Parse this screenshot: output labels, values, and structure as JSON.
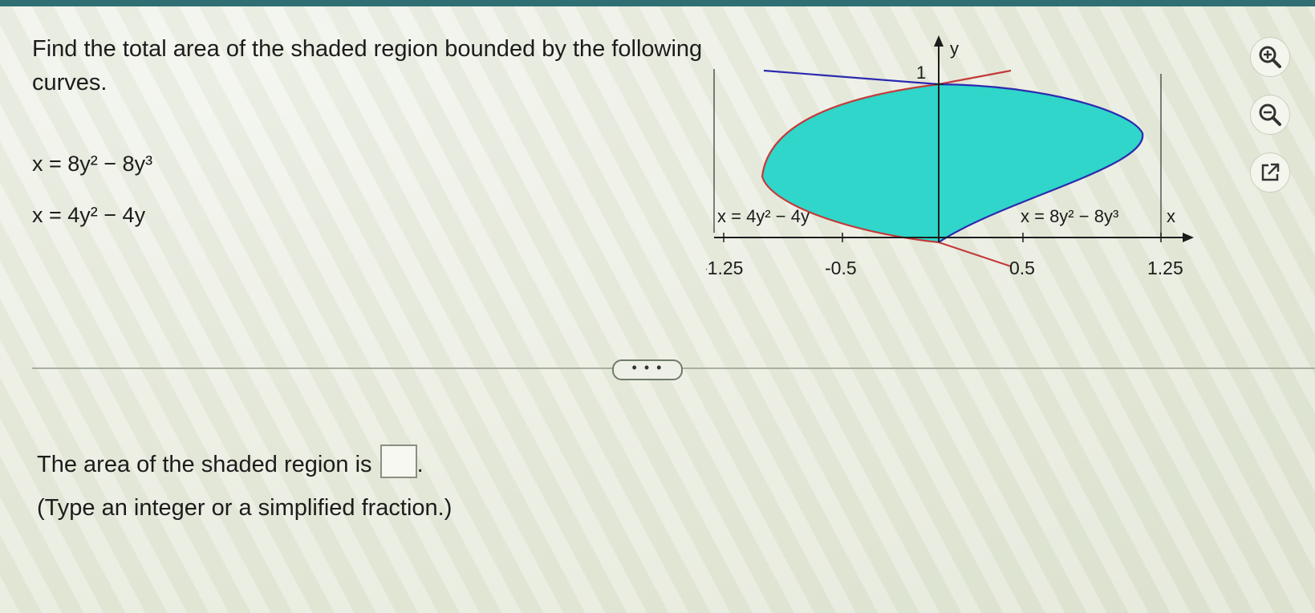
{
  "question": {
    "prompt": "Find the total area of the shaded region bounded by the following curves.",
    "equations": [
      "x = 8y² − 8y³",
      "x = 4y² − 4y"
    ]
  },
  "graph": {
    "y_axis_label": "y",
    "x_axis_label": "x",
    "y_tick_label": "1",
    "x_tick_labels": [
      "-1.25",
      "-0.5",
      "0.5",
      "1.25"
    ],
    "curve_label_left": "x = 4y² − 4y",
    "curve_label_right": "x = 8y² − 8y³",
    "colors": {
      "shade": "#2fd6c9",
      "curve_red": "#c43a3a",
      "curve_blue": "#2c2ab0",
      "axis": "#1c1c1c"
    }
  },
  "tools": [
    {
      "icon": "zoom-in-icon"
    },
    {
      "icon": "zoom-out-icon"
    },
    {
      "icon": "open-external-icon"
    }
  ],
  "expand_button": {
    "label": "• • •"
  },
  "answer": {
    "line1_prefix": "The area of the shaded region is",
    "line1_suffix": ".",
    "hint": "(Type an integer or a simplified fraction.)"
  }
}
